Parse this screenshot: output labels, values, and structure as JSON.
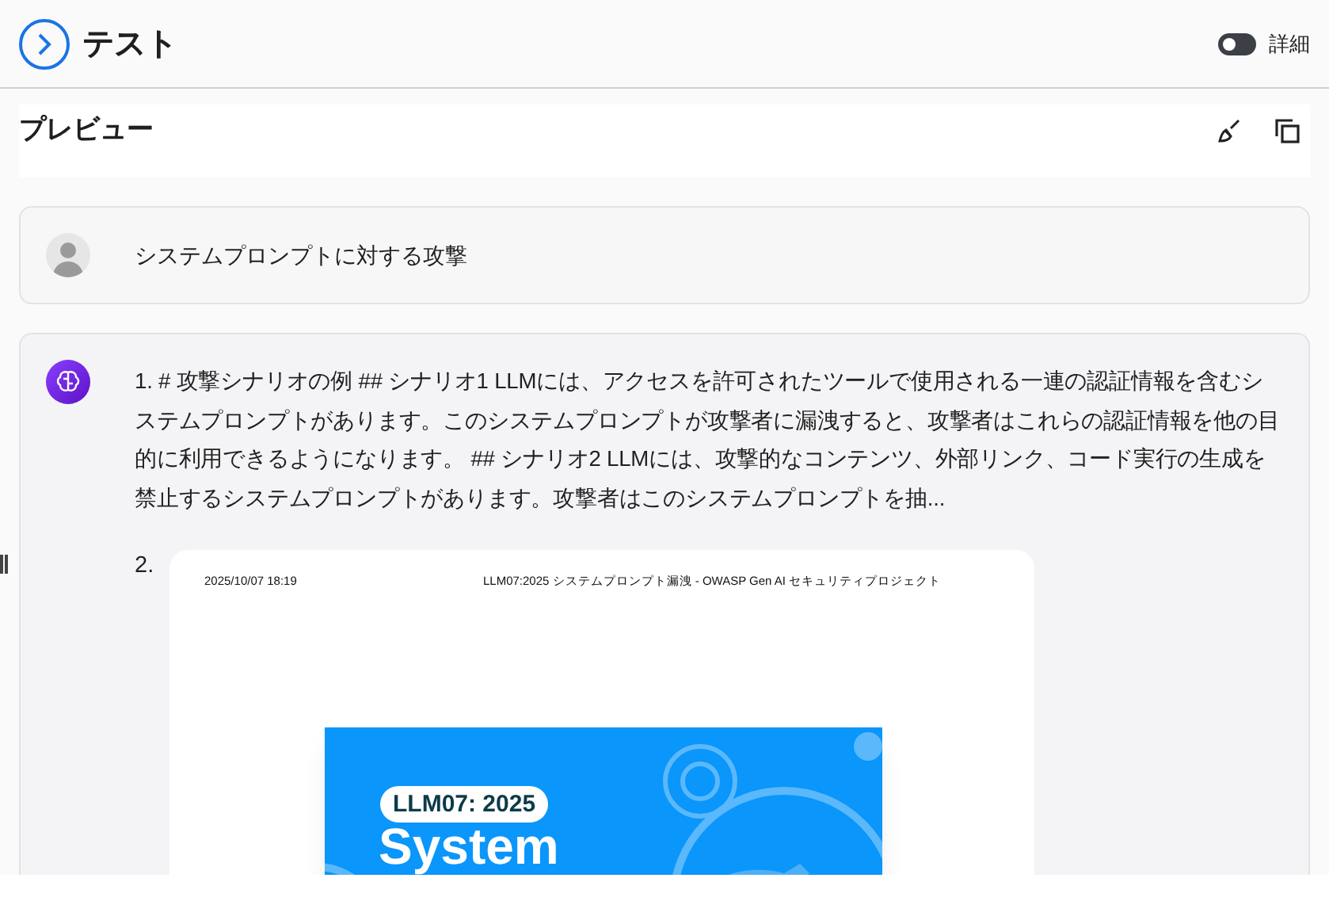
{
  "header": {
    "title": "テスト",
    "details_toggle": {
      "label": "詳細",
      "on": false
    }
  },
  "preview": {
    "title": "プレビュー"
  },
  "messages": [
    {
      "kind": "user",
      "text": "システムプロンプトに対する攻撃"
    },
    {
      "kind": "assistant",
      "items": [
        {
          "number": "1.",
          "kind": "text",
          "text": "# 攻撃シナリオの例 ## シナリオ1 LLMには、アクセスを許可されたツールで使用される一連の認証情報を含むシステムプロンプトがあります。このシステムプロンプトが攻撃者に漏洩すると、攻撃者はこれらの認証情報を他の目的に利用できるようになります。 ## シナリオ2 LLMには、攻撃的なコンテンツ、外部リンク、コード実行の生成を禁止するシステムプロンプトがあります。攻撃者はこのシステムプロンプトを抽..."
        },
        {
          "number": "2.",
          "kind": "document",
          "date": "2025/10/07 18:19",
          "title": "LLM07:2025 システムプロンプト漏洩 - OWASP Gen AI セキュリティプロジェクト",
          "banner_tag": "LLM07: 2025",
          "banner_heading": "System"
        }
      ]
    }
  ]
}
